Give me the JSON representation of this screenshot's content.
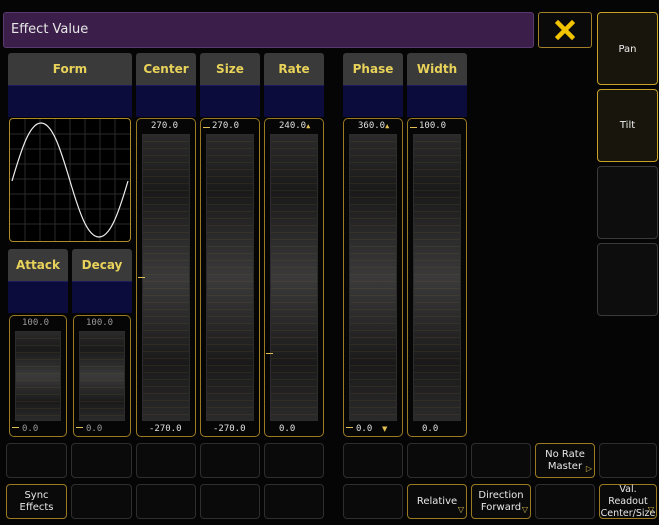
{
  "window": {
    "title": "Effect Value",
    "close_icon": "close-x-icon"
  },
  "side_panel": {
    "items": [
      {
        "label": "Pan",
        "selected": true
      },
      {
        "label": "Tilt",
        "selected": true
      },
      {
        "label": "",
        "selected": false
      },
      {
        "label": "",
        "selected": false
      }
    ]
  },
  "columns": {
    "form": "Form",
    "center": "Center",
    "size": "Size",
    "rate": "Rate",
    "phase": "Phase",
    "width": "Width",
    "attack": "Attack",
    "decay": "Decay"
  },
  "faders": {
    "center": {
      "top": "270.0",
      "bottom": "-270.0"
    },
    "size": {
      "top": "270.0",
      "bottom": "-270.0"
    },
    "rate": {
      "top": "240.0",
      "bottom": "0.0"
    },
    "phase": {
      "top": "360.0",
      "bottom": "0.0"
    },
    "width": {
      "top": "100.0",
      "bottom": "0.0"
    },
    "attack": {
      "top": "100.0",
      "bottom": "0.0"
    },
    "decay": {
      "top": "100.0",
      "bottom": "0.0"
    }
  },
  "bottom_row1": {
    "no_rate_master": "No Rate\nMaster"
  },
  "bottom_row2": {
    "sync_effects": "Sync\nEffects",
    "relative": "Relative",
    "direction": "Direction\nForward",
    "val_readout": "Val. Readout\nCenter/Size"
  },
  "colors": {
    "accent": "#e8d25a",
    "border_gold": "#9a7a22",
    "title_bg": "#3b1f4a",
    "header_bg": "#3a3a3a",
    "value_bg": "#0c0c3c"
  }
}
